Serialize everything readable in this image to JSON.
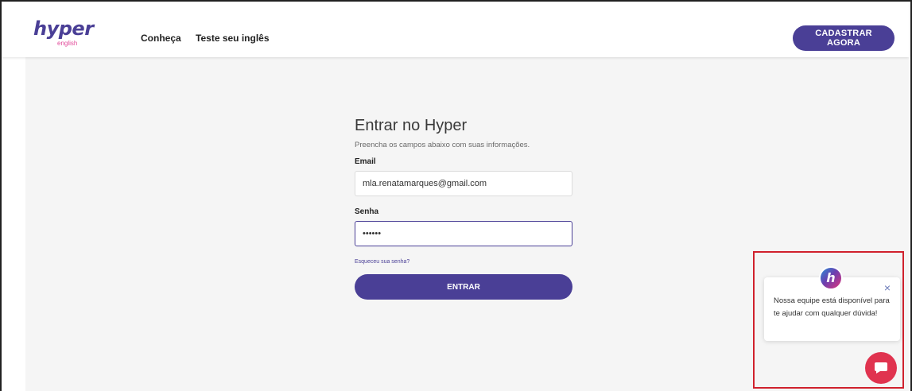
{
  "header": {
    "logo_text": "hyper",
    "logo_sub": "english",
    "nav": [
      "Conheça",
      "Teste seu inglês"
    ],
    "cta_label": "CADASTRAR AGORA"
  },
  "login": {
    "title": "Entrar no Hyper",
    "subtitle": "Preencha os campos abaixo com suas informações.",
    "email_label": "Email",
    "email_value": "mla.renatamarques@gmail.com",
    "password_label": "Senha",
    "password_masked": "••••••",
    "forgot_label": "Esqueceu sua senha?",
    "submit_label": "ENTRAR"
  },
  "chat_widget": {
    "avatar_letter": "h",
    "message": "Nossa equipe está disponível para te ajudar com qualquer dúvida!",
    "close_symbol": "×",
    "launcher_icon": "chat-bubble-icon"
  },
  "colors": {
    "brand": "#4a3f96",
    "accent_pink": "#e24b9a",
    "chat_launcher": "#e0334f",
    "highlight_border": "#d0212d"
  }
}
